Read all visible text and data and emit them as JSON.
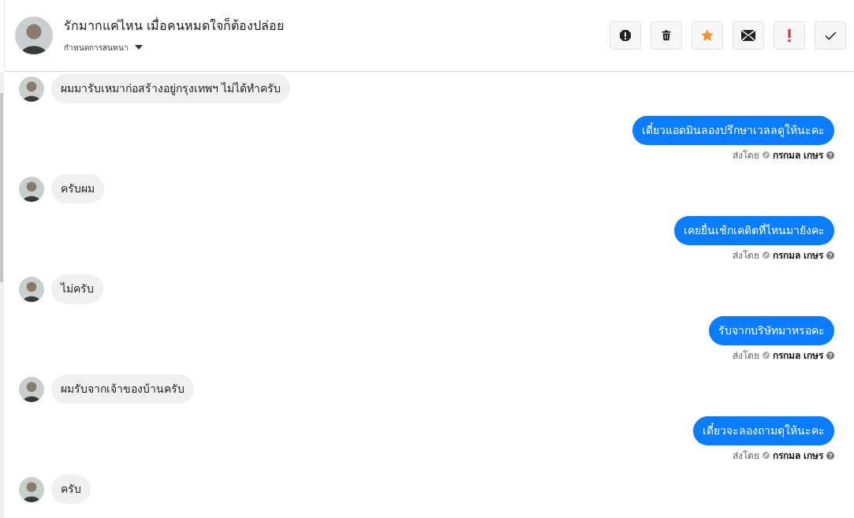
{
  "header": {
    "title": "รักมากแค่ไหน เมื่อคนหมดใจก็ต้องปล่อย",
    "subtitle": "กำหนดการสนทนา"
  },
  "messages": [
    {
      "kind": "incoming",
      "text": "ผมมารับเหมาก่อสร้างอยู่กรุงเทพฯ ไม่ได้ทำครับ"
    },
    {
      "kind": "outgoing",
      "text": "เดี๋ยวแอดมินลองปรึกษาเวลลดูให้นะคะ",
      "sent_by": "ส่งโดย",
      "sender": "กรกมล เกษร"
    },
    {
      "kind": "incoming",
      "text": "ครับผม"
    },
    {
      "kind": "outgoing",
      "text": "เคยยื่นเช้กเคดิตที่ไหนมายังคะ",
      "sent_by": "ส่งโดย",
      "sender": "กรกมล เกษร"
    },
    {
      "kind": "incoming",
      "text": "ไม่ครับ"
    },
    {
      "kind": "outgoing",
      "text": "รับจากบริษัทมาหรอคะ",
      "sent_by": "ส่งโดย",
      "sender": "กรกมล เกษร"
    },
    {
      "kind": "incoming",
      "text": "ผมรับจากเจ้าของบ้านครับ"
    },
    {
      "kind": "outgoing",
      "text": "เดี๋ยวจะลองถามดุให้นะคะ",
      "sent_by": "ส่งโดย",
      "sender": "กรกมล เกษร"
    },
    {
      "kind": "incoming",
      "text": "ครับ"
    }
  ]
}
